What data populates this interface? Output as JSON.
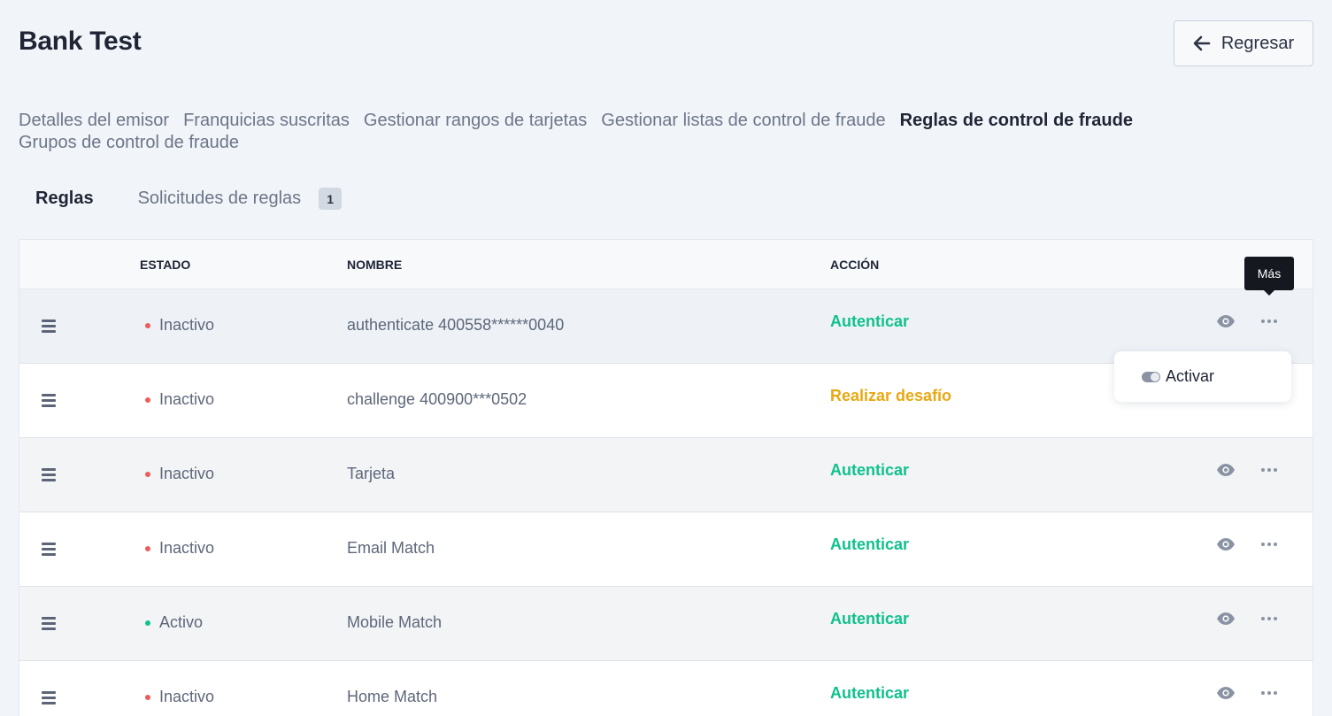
{
  "header": {
    "title": "Bank Test",
    "back_label": "Regresar"
  },
  "nav": {
    "items": [
      "Detalles del emisor",
      "Franquicias suscritas",
      "Gestionar rangos de tarjetas",
      "Gestionar listas de control de fraude",
      "Reglas de control de fraude",
      "Grupos de control de fraude"
    ],
    "active_index": 4
  },
  "subtabs": {
    "rules_label": "Reglas",
    "requests_label": "Solicitudes de reglas",
    "requests_count": "1"
  },
  "table": {
    "headers": {
      "status": "ESTADO",
      "name": "NOMBRE",
      "action": "ACCIÓN"
    },
    "rows": [
      {
        "status": "Inactivo",
        "status_color": "#ef5b5b",
        "name": "authenticate 400558******0040",
        "action": "Autenticar",
        "action_color": "#10c18d"
      },
      {
        "status": "Inactivo",
        "status_color": "#ef5b5b",
        "name": "challenge 400900***0502",
        "action": "Realizar desafío",
        "action_color": "#e8a812"
      },
      {
        "status": "Inactivo",
        "status_color": "#ef5b5b",
        "name": "Tarjeta",
        "action": "Autenticar",
        "action_color": "#10c18d"
      },
      {
        "status": "Inactivo",
        "status_color": "#ef5b5b",
        "name": "Email Match",
        "action": "Autenticar",
        "action_color": "#10c18d"
      },
      {
        "status": "Activo",
        "status_color": "#10c18d",
        "name": "Mobile Match",
        "action": "Autenticar",
        "action_color": "#10c18d"
      },
      {
        "status": "Inactivo",
        "status_color": "#ef5b5b",
        "name": "Home Match",
        "action": "Autenticar",
        "action_color": "#10c18d"
      }
    ]
  },
  "tooltip": {
    "label": "Más"
  },
  "menu": {
    "activate_label": "Activar"
  },
  "icons": {
    "back": "arrow-left-icon",
    "drag": "drag-handle-icon",
    "view": "eye-icon",
    "more": "more-dots-icon",
    "toggle": "toggle-icon"
  }
}
